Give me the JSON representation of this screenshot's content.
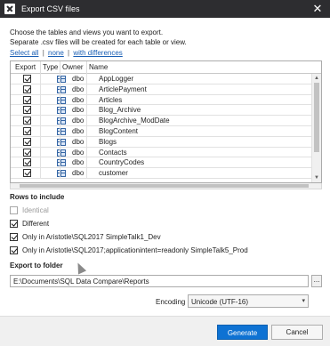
{
  "window": {
    "title": "Export CSV files",
    "close_glyph": "✕",
    "app_icon": "app-icon"
  },
  "intro": {
    "line1": "Choose the tables and views you want to export.",
    "line2": "Separate .csv files will be created for each table or view."
  },
  "links": {
    "select_all": "Select all",
    "separator": "|",
    "none": "none",
    "with_differences": "with differences"
  },
  "table": {
    "columns": [
      "Export",
      "Type",
      "Owner",
      "Name"
    ],
    "rows": [
      {
        "export": true,
        "type_icon": "table-icon",
        "owner": "dbo",
        "name": "AppLogger"
      },
      {
        "export": true,
        "type_icon": "table-icon",
        "owner": "dbo",
        "name": "ArticlePayment"
      },
      {
        "export": true,
        "type_icon": "table-icon",
        "owner": "dbo",
        "name": "Articles"
      },
      {
        "export": true,
        "type_icon": "table-icon",
        "owner": "dbo",
        "name": "Blog_Archive"
      },
      {
        "export": true,
        "type_icon": "table-icon",
        "owner": "dbo",
        "name": "BlogArchive_ModDate"
      },
      {
        "export": true,
        "type_icon": "table-icon",
        "owner": "dbo",
        "name": "BlogContent"
      },
      {
        "export": true,
        "type_icon": "table-icon",
        "owner": "dbo",
        "name": "Blogs"
      },
      {
        "export": true,
        "type_icon": "table-icon",
        "owner": "dbo",
        "name": "Contacts"
      },
      {
        "export": true,
        "type_icon": "table-icon",
        "owner": "dbo",
        "name": "CountryCodes"
      },
      {
        "export": true,
        "type_icon": "table-icon",
        "owner": "dbo",
        "name": "customer"
      }
    ]
  },
  "rows_to_include": {
    "title": "Rows to include",
    "options": [
      {
        "label": "Identical",
        "checked": false,
        "disabled": true
      },
      {
        "label": "Different",
        "checked": true,
        "disabled": false
      },
      {
        "label": "Only in Aristotle\\SQL2017 SimpleTalk1_Dev",
        "checked": true,
        "disabled": false
      },
      {
        "label": "Only in Aristotle\\SQL2017;applicationintent=readonly SimpleTalk5_Prod",
        "checked": true,
        "disabled": false
      }
    ]
  },
  "export_folder": {
    "title": "Export to folder",
    "path": "E:\\Documents\\SQL Data Compare\\Reports",
    "browse_label": "..."
  },
  "encoding": {
    "label": "Encoding",
    "value": "Unicode (UTF-16)",
    "caret": "▾"
  },
  "buttons": {
    "generate": "Generate",
    "cancel": "Cancel"
  },
  "colors": {
    "titlebar": "#2d2d30",
    "primary": "#0e72d3",
    "link": "#1a5fb4"
  }
}
